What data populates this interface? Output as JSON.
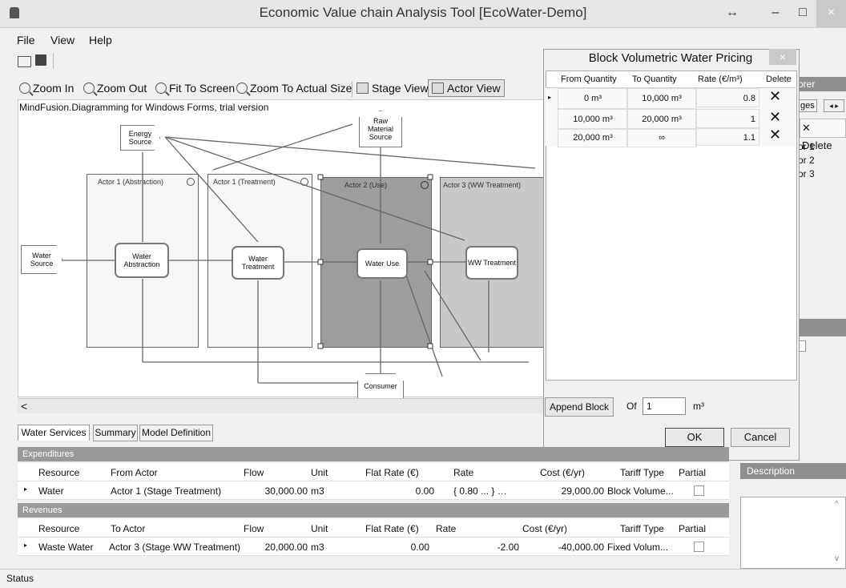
{
  "window": {
    "title": "Economic Value chain Analysis Tool [EcoWater-Demo]",
    "minimize": "–",
    "maximize": "□",
    "close": "×",
    "resize": "↔"
  },
  "menu": [
    "File",
    "View",
    "Help"
  ],
  "toolbar": {
    "zoom_in": "Zoom In",
    "zoom_out": "Zoom Out",
    "fit": "Fit To Screen",
    "actual": "Zoom To Actual Size",
    "stage_view": "Stage View",
    "actor_view": "Actor View"
  },
  "diagram": {
    "watermark": "MindFusion.Diagramming for Windows Forms, trial version",
    "actors": [
      "Actor 1 (Abstraction)",
      "Actor 1 (Treatment)",
      "Actor 2 (Use)",
      "Actor 3 (WW Treatment)"
    ],
    "nodes": {
      "energy": "Energy Source",
      "raw": "Raw Material Source",
      "water_source": "Water Source",
      "abstraction": "Water Abstraction",
      "treatment": "Water Treatment",
      "use": "Water Use",
      "ww": "WW Treatment",
      "consumer": "Consumer"
    },
    "scroll_left": "<"
  },
  "explorer": {
    "title": "orer",
    "tab": "ges",
    "delete": "Delete",
    "items": [
      "or 1",
      "or 2",
      "or 3"
    ]
  },
  "dialog": {
    "title": "Block Volumetric Water Pricing",
    "close": "×",
    "columns": [
      "From Quantity",
      "To Quantity",
      "Rate (€/m³)",
      "Delete"
    ],
    "rows": [
      {
        "from": "0 m³",
        "to": "10,000 m³",
        "rate": "0.8"
      },
      {
        "from": "10,000 m³",
        "to": "20,000 m³",
        "rate": "1"
      },
      {
        "from": "20,000 m³",
        "to": "∞",
        "rate": "1.1"
      }
    ],
    "delete_glyph": "✕",
    "append_label": "Append Block",
    "of_label": "Of",
    "of_value": "1",
    "unit": "m³",
    "ok": "OK",
    "cancel": "Cancel"
  },
  "tabs": [
    "Water Services",
    "Summary",
    "Model Definition"
  ],
  "expenditures": {
    "title": "Expenditures",
    "columns": [
      "Resource",
      "From Actor",
      "Flow",
      "Unit",
      "Flat Rate (€)",
      "Rate",
      "Cost (€/yr)",
      "Tariff Type",
      "Partial"
    ],
    "row": {
      "resource": "Water",
      "actor": "Actor 1 (Stage Treatment)",
      "flow": "30,000.00",
      "unit": "m3",
      "flat": "0.00",
      "rate": "{ 0.80 ... } …",
      "cost": "29,000.00",
      "tariff": "Block Volume..."
    }
  },
  "revenues": {
    "title": "Revenues",
    "columns": [
      "Resource",
      "To Actor",
      "Flow",
      "Unit",
      "Flat Rate (€)",
      "Rate",
      "Cost (€/yr)",
      "Tariff Type",
      "Partial"
    ],
    "row": {
      "resource": "Waste Water",
      "actor": "Actor 3 (Stage WW Treatment)",
      "flow": "20,000.00",
      "unit": "m3",
      "flat": "0.00",
      "rate": "-2.00",
      "cost": "-40,000.00",
      "tariff": "Fixed Volum..."
    }
  },
  "description": "Description",
  "status": "Status"
}
